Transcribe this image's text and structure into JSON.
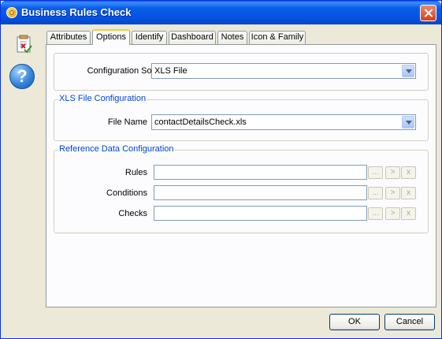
{
  "window": {
    "title": "Business Rules Check"
  },
  "tabs": [
    {
      "label": "Attributes"
    },
    {
      "label": "Options"
    },
    {
      "label": "Identify"
    },
    {
      "label": "Dashboard"
    },
    {
      "label": "Notes"
    },
    {
      "label": "Icon & Family"
    }
  ],
  "active_tab": "Options",
  "options": {
    "configuration_source": {
      "label": "Configuration Source",
      "value": "XLS File"
    },
    "xls_group": {
      "legend": "XLS File Configuration",
      "file_name": {
        "label": "File Name",
        "value": "contactDetailsCheck.xls"
      }
    },
    "reference_group": {
      "legend": "Reference Data Configuration",
      "rows": [
        {
          "label": "Rules",
          "value": ""
        },
        {
          "label": "Conditions",
          "value": ""
        },
        {
          "label": "Checks",
          "value": ""
        }
      ],
      "browse_label": "...",
      "go_label": ">",
      "clear_label": "x"
    }
  },
  "buttons": {
    "ok": "OK",
    "cancel": "Cancel"
  },
  "icons": {
    "side_1": "rules-document-icon",
    "side_2": "help-icon"
  }
}
